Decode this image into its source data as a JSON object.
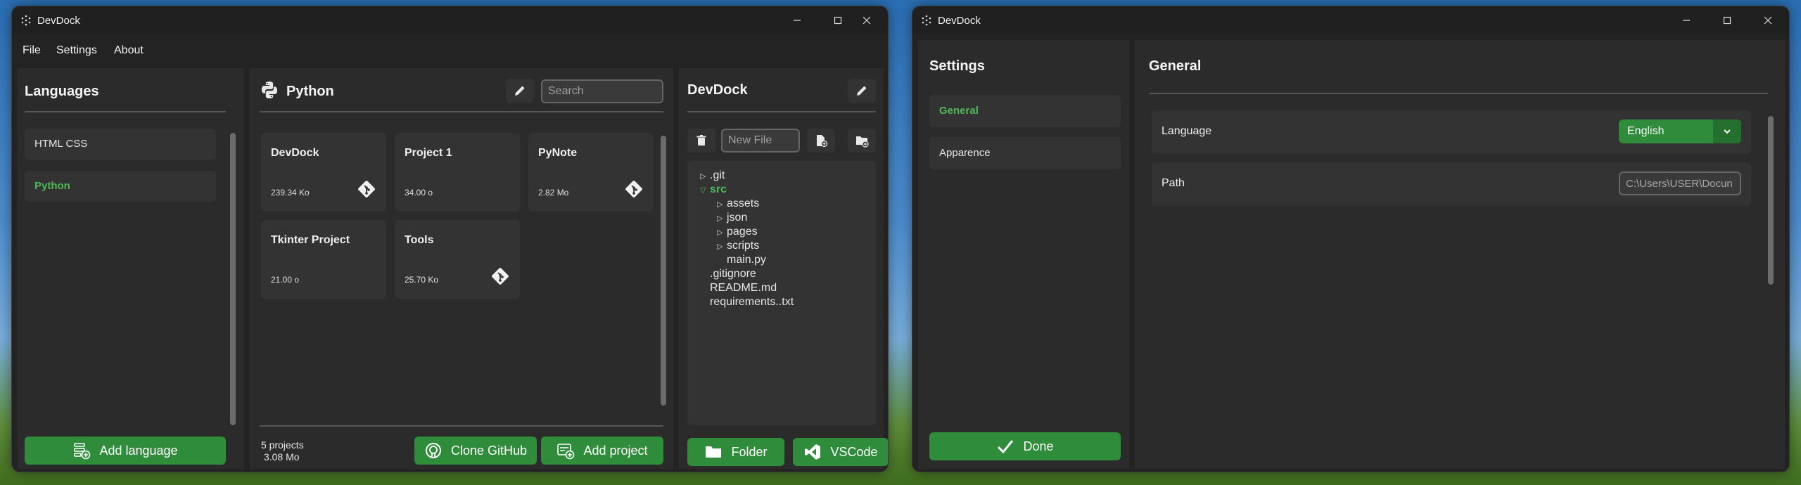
{
  "main_window": {
    "title": "DevDock",
    "menu": [
      "File",
      "Settings",
      "About"
    ],
    "languages_panel": {
      "title": "Languages",
      "items": [
        {
          "label": "HTML CSS",
          "active": false
        },
        {
          "label": "Python",
          "active": true
        }
      ],
      "add_button": "Add language"
    },
    "projects_panel": {
      "title": "Python",
      "search_placeholder": "Search",
      "projects": [
        {
          "name": "DevDock",
          "size": "239.34 Ko",
          "git": true
        },
        {
          "name": "Project 1",
          "size": "34.00 o",
          "git": false
        },
        {
          "name": "PyNote",
          "size": "2.82 Mo",
          "git": true
        },
        {
          "name": "Tkinter Project",
          "size": "21.00 o",
          "git": false
        },
        {
          "name": "Tools",
          "size": "25.70 Ko",
          "git": true
        }
      ],
      "footer_count": "5 projects",
      "footer_size": "3.08 Mo",
      "clone_button": "Clone GitHub",
      "add_button": "Add project"
    },
    "files_panel": {
      "title": "DevDock",
      "new_file_placeholder": "New File",
      "tree": [
        {
          "name": ".git",
          "level": 0,
          "arrow": "closed"
        },
        {
          "name": "src",
          "level": 0,
          "arrow": "open"
        },
        {
          "name": "assets",
          "level": 1,
          "arrow": "closed"
        },
        {
          "name": "json",
          "level": 1,
          "arrow": "closed"
        },
        {
          "name": "pages",
          "level": 1,
          "arrow": "closed"
        },
        {
          "name": "scripts",
          "level": 1,
          "arrow": "closed"
        },
        {
          "name": "main.py",
          "level": 1,
          "arrow": "none"
        },
        {
          "name": ".gitignore",
          "level": 0,
          "arrow": "none"
        },
        {
          "name": "README.md",
          "level": 0,
          "arrow": "none"
        },
        {
          "name": "requirements..txt",
          "level": 0,
          "arrow": "none"
        }
      ],
      "folder_button": "Folder",
      "vscode_button": "VSCode"
    }
  },
  "settings_window": {
    "title": "DevDock",
    "sidebar_title": "Settings",
    "nav": [
      {
        "label": "General",
        "active": true
      },
      {
        "label": "Apparence",
        "active": false
      }
    ],
    "done_button": "Done",
    "section_title": "General",
    "language_label": "Language",
    "language_value": "English",
    "path_label": "Path",
    "path_value": "C:\\Users\\USER\\Docun"
  },
  "colors": {
    "accent_green": "#2f8c3a",
    "active_text_green": "#4fb957",
    "panel_bg": "#2b2b2b",
    "card_bg": "#333333"
  }
}
